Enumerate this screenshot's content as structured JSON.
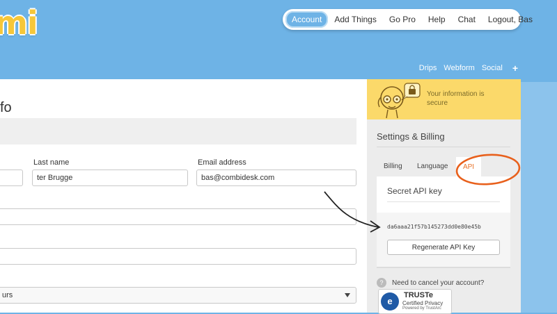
{
  "logo": {
    "text": "mi"
  },
  "topnav": {
    "items": [
      {
        "label": "Account",
        "active": true
      },
      {
        "label": "Add Things"
      },
      {
        "label": "Go Pro"
      },
      {
        "label": "Help"
      },
      {
        "label": "Chat"
      },
      {
        "label": "Logout, Bas"
      }
    ]
  },
  "subnav": {
    "drips": "Drips",
    "webform": "Webform",
    "social": "Social",
    "plus": "+"
  },
  "main": {
    "title": "fo",
    "last_name_label": "Last name",
    "last_name_value": "ter Brugge",
    "email_label": "Email address",
    "email_value": "bas@combidesk.com",
    "select_value": "urs"
  },
  "sidebar": {
    "secure_text": "Your information is secure",
    "settings_title": "Settings & Billing",
    "tabs": {
      "billing": "Billing",
      "language": "Language",
      "api": "API"
    },
    "api": {
      "heading": "Secret API key",
      "key": "da6aaa21f57b145273dd0e80e45b",
      "regen_label": "Regenerate API Key"
    },
    "cancel_text": "Need to cancel your account?",
    "truste": {
      "title": "TRUSTe",
      "sub": "Certified Privacy",
      "small": "Powered by TrustArc"
    }
  },
  "colors": {
    "header_bg": "#6eb3e6",
    "accent": "#e8732a",
    "secure_bg": "#fbd96a"
  }
}
